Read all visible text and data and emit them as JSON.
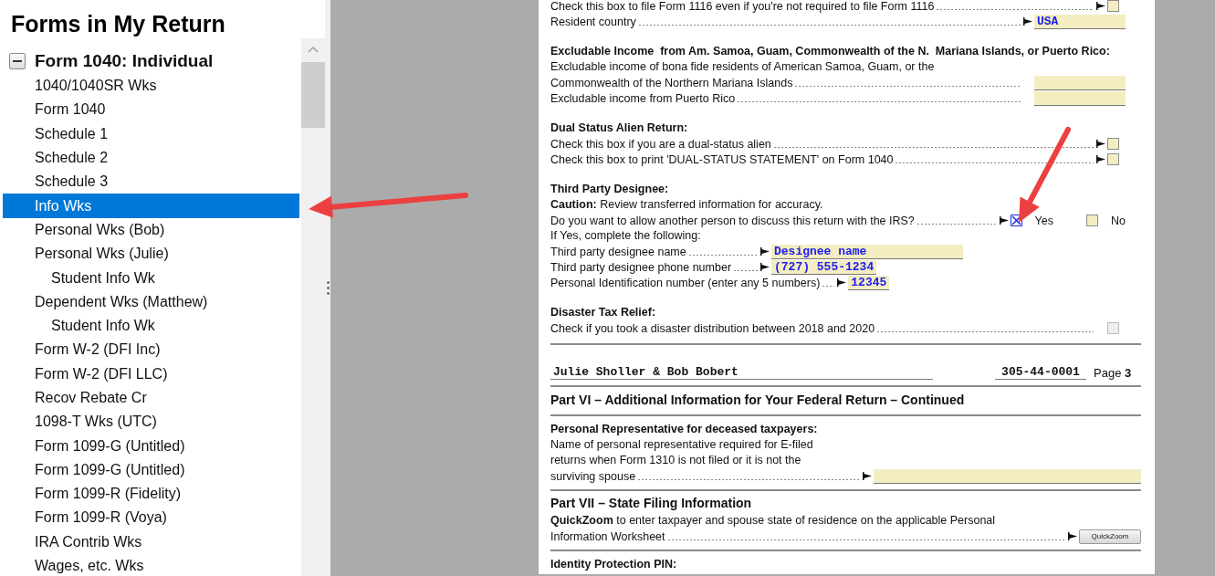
{
  "sidebar": {
    "title": "Forms in My Return",
    "tree": [
      {
        "label": "Form 1040:  Individual",
        "expanded": true,
        "selected": false,
        "children": [
          {
            "label": "1040/1040SR Wks",
            "selected": false
          },
          {
            "label": "Form 1040",
            "selected": false
          },
          {
            "label": "Schedule 1",
            "selected": false
          },
          {
            "label": "Schedule 2",
            "selected": false
          },
          {
            "label": "Schedule 3",
            "selected": false
          },
          {
            "label": "Info Wks",
            "selected": true
          },
          {
            "label": "Personal Wks (Bob)",
            "selected": false
          },
          {
            "label": "Personal Wks (Julie)",
            "selected": false,
            "children": [
              {
                "label": "Student Info Wk",
                "selected": false
              }
            ]
          },
          {
            "label": "Dependent Wks (Matthew)",
            "selected": false,
            "children": [
              {
                "label": "Student Info Wk",
                "selected": false
              }
            ]
          },
          {
            "label": "Form W-2 (DFI Inc)",
            "selected": false
          },
          {
            "label": "Form W-2 (DFI LLC)",
            "selected": false
          },
          {
            "label": "Recov Rebate Cr",
            "selected": false
          },
          {
            "label": "1098-T Wks (UTC)",
            "selected": false
          },
          {
            "label": "Form 1099-G (Untitled)",
            "selected": false
          },
          {
            "label": "Form 1099-G (Untitled)",
            "selected": false
          },
          {
            "label": "Form 1099-R (Fidelity)",
            "selected": false
          },
          {
            "label": "Form 1099-R (Voya)",
            "selected": false
          },
          {
            "label": "IRA Contrib Wks",
            "selected": false
          },
          {
            "label": "Wages, etc. Wks",
            "selected": false
          }
        ]
      }
    ]
  },
  "form": {
    "upper": [
      {
        "kind": "check",
        "label": "Check this box to file Form 1116 even if you're not required to file Form 1116",
        "pointer": true,
        "checked": false,
        "disabled": false
      },
      {
        "kind": "field",
        "label": "Resident country",
        "pointer": true,
        "value": "USA"
      },
      {
        "kind": "heading",
        "text": "Excludable Income  from Am. Samoa, Guam, Commonwealth of the N.  Mariana Islands, or Puerto Rico:"
      },
      {
        "kind": "text",
        "text": "Excludable income of bona fide residents of American Samoa, Guam, or the"
      },
      {
        "kind": "field",
        "label": "Commonwealth of the Northern Mariana Islands",
        "pointer": false
      },
      {
        "kind": "field",
        "label": "Excludable income from Puerto Rico",
        "pointer": false
      },
      {
        "kind": "heading",
        "text": "Dual Status Alien Return:"
      },
      {
        "kind": "check",
        "label": "Check this box if you are a dual-status alien",
        "pointer": true,
        "checked": false,
        "disabled": false
      },
      {
        "kind": "check",
        "label": "Check this box to print 'DUAL-STATUS STATEMENT' on Form 1040",
        "pointer": true,
        "checked": false,
        "disabled": false
      },
      {
        "kind": "heading",
        "text": "Third Party Designee:"
      },
      {
        "kind": "text",
        "text": "**Caution:** Review transferred information for accuracy."
      },
      {
        "kind": "yes_no",
        "label": "Do you want to allow another person to discuss this return with the IRS?",
        "pointer": true,
        "options": [
          {
            "label": "Yes",
            "checked": true
          },
          {
            "label": "No",
            "checked": false
          }
        ]
      },
      {
        "kind": "text",
        "text": "If Yes, complete the following:"
      },
      {
        "kind": "inline_field",
        "label": "Third party designee name",
        "pointer": true,
        "value": "Designee name"
      },
      {
        "kind": "inline_field",
        "label": "Third party designee phone number",
        "pointer": true,
        "value": "(727) 555-1234"
      },
      {
        "kind": "inline_field",
        "label": "Personal Identification number (enter any 5 numbers)",
        "pointer": true,
        "value": "12345"
      },
      {
        "kind": "heading",
        "text": "Disaster Tax Relief:"
      },
      {
        "kind": "check",
        "label": "Check if you took a disaster distribution between 2018 and 2020",
        "pointer": false,
        "checked": false,
        "disabled": true
      }
    ],
    "header": {
      "names": "Julie Sholler & Bob Bobert",
      "ssn": "305-44-0001",
      "page": "Page **3**"
    },
    "lower": [
      {
        "kind": "part_title",
        "text": "Part VI – Additional Information for Your Federal Return – Continued"
      },
      {
        "kind": "rule"
      },
      {
        "kind": "heading",
        "text": "Personal Representative for deceased taxpayers:"
      },
      {
        "kind": "text",
        "text": "Name of personal representative required for E-filed"
      },
      {
        "kind": "text",
        "text": "returns when Form 1310 is not filed or it is not the"
      },
      {
        "kind": "line_field",
        "label": "surviving spouse",
        "pointer": true
      },
      {
        "kind": "rule"
      },
      {
        "kind": "part_title",
        "text": "Part VII – State Filing Information"
      },
      {
        "kind": "text",
        "text": "**QuickZoom** to enter taxpayer and spouse state of residence on the applicable Personal"
      },
      {
        "kind": "button_row",
        "label": "Information Worksheet",
        "pointer": true,
        "button": "QuickZoom"
      },
      {
        "kind": "rule"
      },
      {
        "kind": "heading",
        "text": "Identity Protection PIN:"
      }
    ]
  },
  "annotations": [
    {
      "kind": "arrow"
    },
    {
      "kind": "arrow"
    }
  ]
}
